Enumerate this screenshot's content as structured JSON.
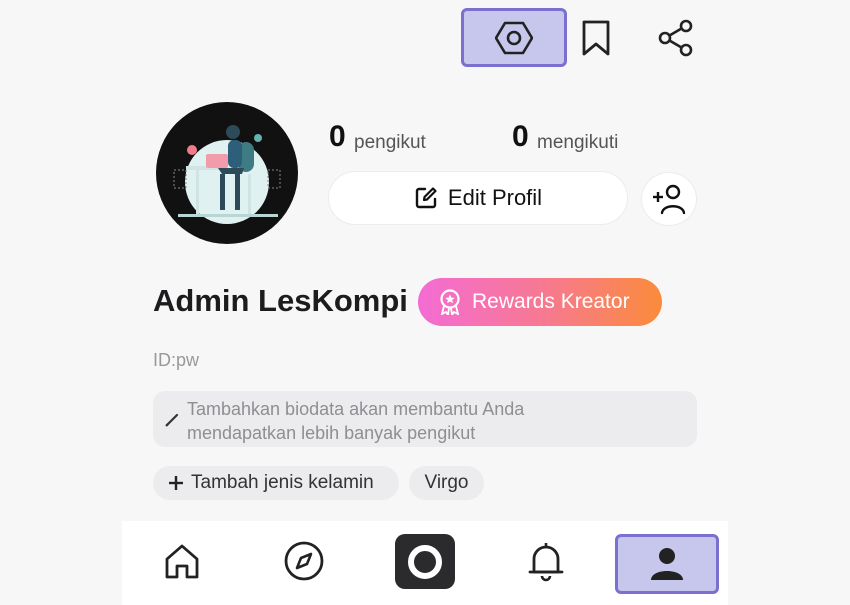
{
  "stats": {
    "followers_count": "0",
    "followers_label": "pengikut",
    "following_count": "0",
    "following_label": "mengikuti"
  },
  "actions": {
    "edit_profile_label": "Edit Profil"
  },
  "profile": {
    "name": "Admin LesKompi",
    "rewards_label": "Rewards Kreator",
    "id": "ID:pw",
    "bio_placeholder_line1": "Tambahkan biodata akan membantu Anda",
    "bio_placeholder_line2": "mendapatkan lebih banyak pengikut",
    "gender_chip": "Tambah jenis kelamin",
    "zodiac_chip": "Virgo"
  },
  "icons": {
    "top": [
      "settings-icon",
      "bookmark-icon",
      "share-icon"
    ],
    "nav": [
      "home-icon",
      "compass-icon",
      "create-icon",
      "bell-icon",
      "profile-icon"
    ],
    "add_friend": "add-friend-icon",
    "edit": "edit-icon",
    "rewards": "badge-icon"
  },
  "colors": {
    "highlight_fill": "#c7c6ec",
    "highlight_border": "#7b6fd0",
    "rewards_gradient_start": "#f46cd4",
    "rewards_gradient_end": "#fb8b3a"
  }
}
